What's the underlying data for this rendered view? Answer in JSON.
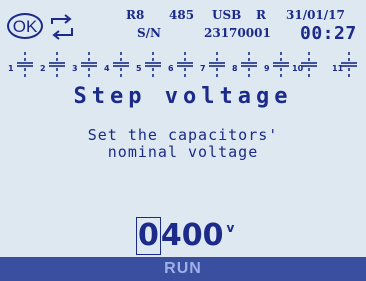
{
  "status": {
    "relay": "R8",
    "protocol": "485",
    "port": "USB",
    "mode": "R",
    "date": "31/01/17",
    "sn_label": "S/N",
    "serial": "23170001",
    "time": "00:27"
  },
  "icons": {
    "ok": "OK",
    "cycle": "cycle-arrows-icon"
  },
  "steps": [
    "1",
    "2",
    "3",
    "4",
    "5",
    "6",
    "7",
    "8",
    "9",
    "10",
    "11"
  ],
  "title": "Step voltage",
  "description_line1": "Set the capacitors'",
  "description_line2": "nominal voltage",
  "value": {
    "cursor_digit": "0",
    "rest": "400",
    "unit": "v"
  },
  "bottom_bar": {
    "label": "RUN"
  },
  "colors": {
    "background": "#dde8f1",
    "text": "#1c2a8a",
    "bar": "#3a4fa0",
    "bar_text": "#9fb0e8"
  }
}
